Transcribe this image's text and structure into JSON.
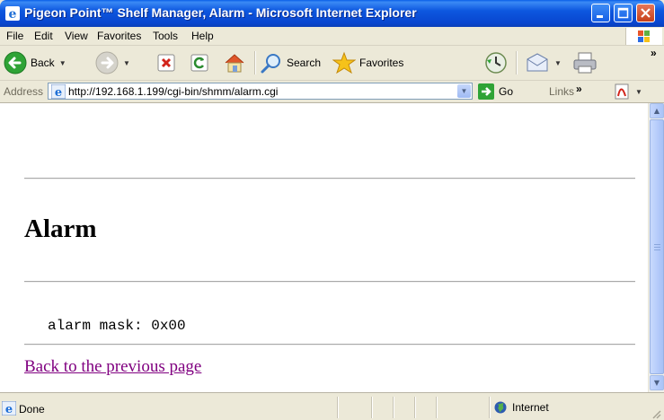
{
  "window": {
    "title": "Pigeon Point™ Shelf Manager, Alarm - Microsoft Internet Explorer"
  },
  "menu": [
    "File",
    "Edit",
    "View",
    "Favorites",
    "Tools",
    "Help"
  ],
  "toolbar": {
    "back_label": "Back",
    "search_label": "Search",
    "favorites_label": "Favorites"
  },
  "address": {
    "label": "Address",
    "url": "http://192.168.1.199/cgi-bin/shmm/alarm.cgi",
    "go_label": "Go",
    "links_label": "Links",
    "more_glyph": "»"
  },
  "page": {
    "heading": "Alarm",
    "mask_text": "alarm mask: 0x00",
    "back_link": "Back to the previous page"
  },
  "status": {
    "text": "Done",
    "zone": "Internet"
  },
  "colors": {
    "link_visited": "#800080",
    "title_bar": "#0a4fd8"
  }
}
